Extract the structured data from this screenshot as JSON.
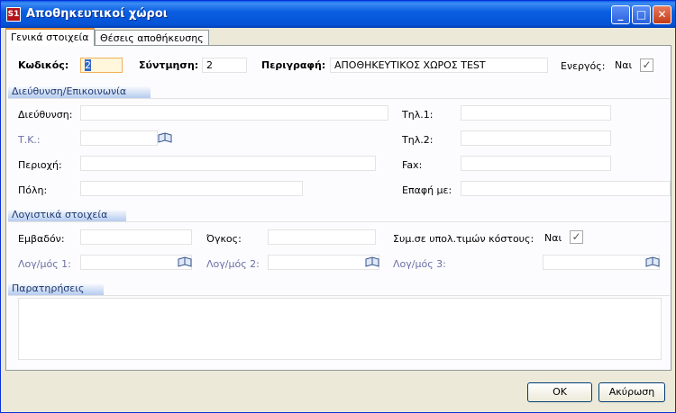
{
  "window": {
    "title": "Αποθηκευτικοί χώροι",
    "app_icon": "S1"
  },
  "tabs": [
    {
      "label": "Γενικά στοιχεία"
    },
    {
      "label": "Θέσεις αποθήκευσης"
    }
  ],
  "header": {
    "code_label": "Κωδικός:",
    "code_value": "2",
    "short_label": "Σύντμηση:",
    "short_value": "2",
    "desc_label": "Περιγραφή:",
    "desc_value": "ΑΠΟΘΗΚΕΥΤΙΚΟΣ ΧΩΡΟΣ TEST",
    "active_label": "Ενεργός:",
    "active_value": "Ναι",
    "active_checked": true
  },
  "address_section": {
    "title": "Διεύθυνση/Επικοινωνία",
    "address_label": "Διεύθυνση:",
    "tk_label": "Τ.Κ.:",
    "area_label": "Περιοχή:",
    "city_label": "Πόλη:",
    "phone1_label": "Τηλ.1:",
    "phone2_label": "Τηλ.2:",
    "fax_label": "Fax:",
    "contact_label": "Επαφή με:"
  },
  "accounting_section": {
    "title": "Λογιστικά στοιχεία",
    "area_label": "Εμβαδόν:",
    "volume_label": "Όγκος:",
    "cost_label": "Συμ.σε υπολ.τιμών κόστους:",
    "cost_value": "Ναι",
    "cost_checked": true,
    "acc1_label": "Λογ/μός 1:",
    "acc2_label": "Λογ/μός 2:",
    "acc3_label": "Λογ/μός 3:"
  },
  "notes_section": {
    "title": "Παρατηρήσεις"
  },
  "footer": {
    "ok_label": "OK",
    "cancel_label": "Ακύρωση"
  }
}
